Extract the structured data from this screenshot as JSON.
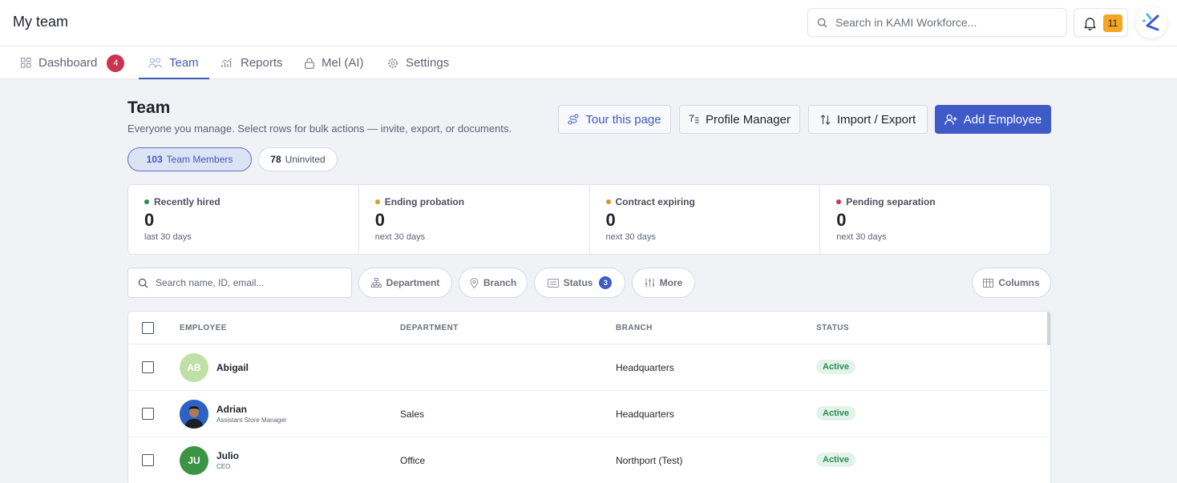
{
  "app": {
    "title": "My team"
  },
  "search": {
    "placeholder": "Search in KAMI Workforce..."
  },
  "notifications": {
    "count": "11"
  },
  "tabs": [
    {
      "label": "Dashboard",
      "badge": "4"
    },
    {
      "label": "Team"
    },
    {
      "label": "Reports"
    },
    {
      "label": "Mel (AI)"
    },
    {
      "label": "Settings"
    }
  ],
  "header": {
    "title": "Team",
    "subtitle": "Everyone you manage. Select rows for bulk actions — invite, export, or documents.",
    "tour_label": "Tour this page",
    "profile_label": "Profile Manager",
    "import_label": "Import / Export",
    "add_label": "Add Employee"
  },
  "segments": {
    "members": {
      "count": "103",
      "label": "Team Members"
    },
    "uninvited": {
      "count": "78",
      "label": "Uninvited"
    }
  },
  "stats": [
    {
      "label": "Recently hired",
      "value": "0",
      "sub": "last 30 days",
      "color": "#2c8a57"
    },
    {
      "label": "Ending probation",
      "value": "0",
      "sub": "next 30 days",
      "color": "#d4a017"
    },
    {
      "label": "Contract expiring",
      "value": "0",
      "sub": "next 30 days",
      "color": "#e0902a"
    },
    {
      "label": "Pending separation",
      "value": "0",
      "sub": "next 30 days",
      "color": "#c9344f"
    }
  ],
  "filters": {
    "search_placeholder": "Search name, ID, email...",
    "department": "Department",
    "branch": "Branch",
    "status": "Status",
    "status_count": "3",
    "more": "More",
    "columns": "Columns"
  },
  "table": {
    "columns": {
      "employee": "EMPLOYEE",
      "department": "DEPARTMENT",
      "branch": "BRANCH",
      "status": "STATUS"
    },
    "rows": [
      {
        "initials": "AB",
        "name": "Abigail",
        "role": "",
        "department": "",
        "branch": "Headquarters",
        "status": "Active",
        "avatar_color": "#bfe0a6"
      },
      {
        "initials": "",
        "name": "Adrian",
        "role": "Assistant Store Manager",
        "department": "Sales",
        "branch": "Headquarters",
        "status": "Active",
        "avatar_color": "#2b62c4"
      },
      {
        "initials": "JU",
        "name": "Julio",
        "role": "CEO",
        "department": "Office",
        "branch": "Northport (Test)",
        "status": "Active",
        "avatar_color": "#3a9444"
      }
    ]
  },
  "colors": {
    "accent": "#3e5bc8",
    "badge_red": "#c9344f",
    "notif_orange": "#f5a623"
  }
}
